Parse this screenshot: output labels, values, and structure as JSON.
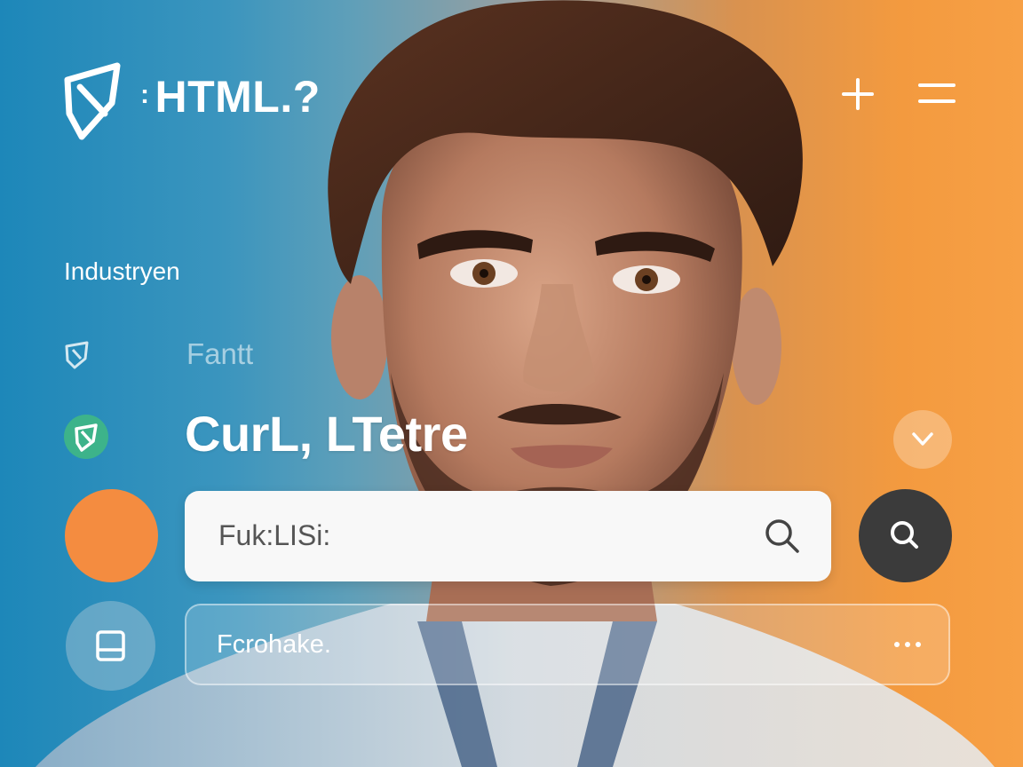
{
  "header": {
    "brand_separator": ":",
    "brand_name": "HTML.?",
    "logo_icon": "shield-logo-icon",
    "add_icon": "plus-icon",
    "menu_icon": "menu-icon"
  },
  "sidebar": {
    "section_label": "Industryen",
    "sub_label": "Fantt",
    "sub_label_icon": "shield-icon"
  },
  "headline": {
    "text": "CurL, LTetre",
    "badge_icon": "shield-badge-icon",
    "toggle_icon": "chevron-down-icon"
  },
  "search": {
    "value": "Fuk:LISi:",
    "inline_icon": "search-icon",
    "button_icon": "search-icon"
  },
  "secondary": {
    "value": "Fcrohake.",
    "left_icon": "document-icon",
    "more_icon": "more-dots-icon"
  },
  "colors": {
    "gradient_left": "#1d87b9",
    "gradient_right": "#f7a045",
    "accent_orange": "#f48c40",
    "accent_green": "#3db38a",
    "search_button": "#3b3b3b",
    "search_bar": "#f8f8f8"
  }
}
